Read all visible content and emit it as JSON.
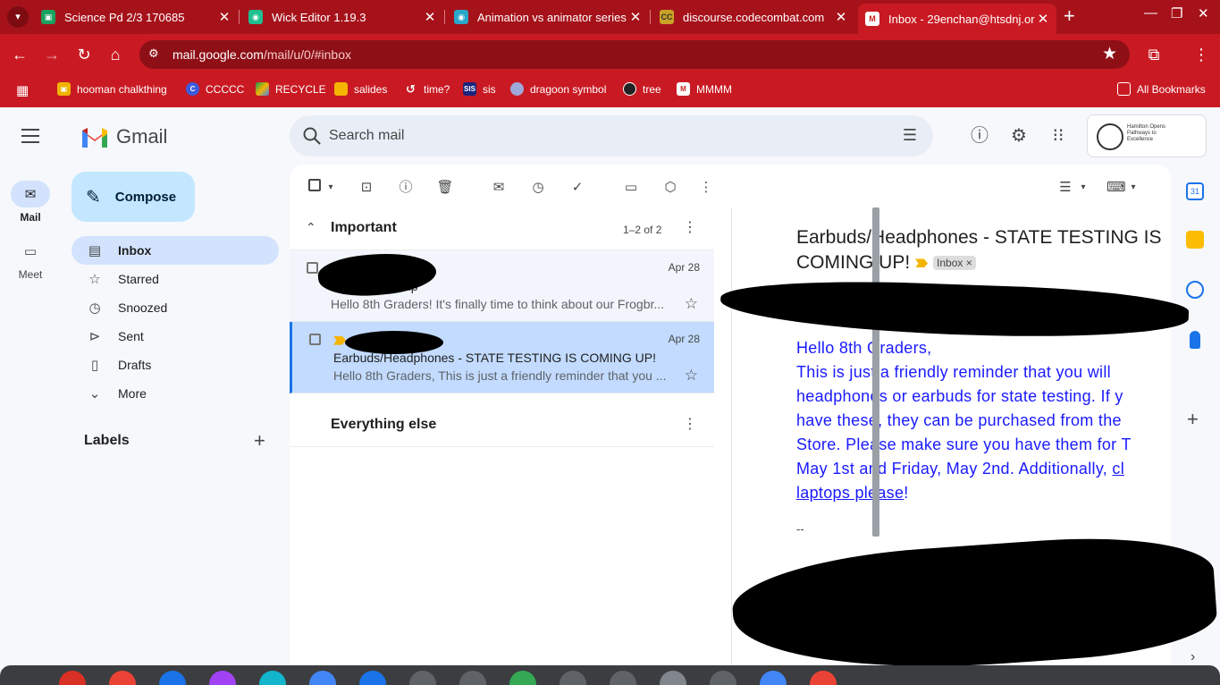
{
  "browser": {
    "tabs": [
      {
        "title": "Science Pd 2/3 170685",
        "active": false
      },
      {
        "title": "Wick Editor 1.19.3",
        "active": false
      },
      {
        "title": "Animation vs animator series",
        "active": false
      },
      {
        "title": "discourse.codecombat.com",
        "active": false
      },
      {
        "title": "Inbox - 29enchan@htsdnj.org",
        "active": true
      }
    ],
    "url_host": "mail.google.com",
    "url_path": "/mail/u/0/#inbox",
    "bookmarks": [
      {
        "label": "hooman chalkthing"
      },
      {
        "label": "CCCCC"
      },
      {
        "label": "RECYCLE"
      },
      {
        "label": "salides"
      },
      {
        "label": "time?"
      },
      {
        "label": "sis"
      },
      {
        "label": "dragoon symbol"
      },
      {
        "label": "tree"
      },
      {
        "label": "MMMM"
      }
    ],
    "all_bookmarks": "All Bookmarks",
    "colors": {
      "frame": "#a6121a",
      "toolbar": "#c91a23"
    }
  },
  "gmail": {
    "brand": "Gmail",
    "rail": [
      {
        "label": "Mail"
      },
      {
        "label": "Meet"
      }
    ],
    "compose": "Compose",
    "search_placeholder": "Search mail",
    "nav": [
      {
        "label": "Inbox",
        "icon": "inbox-icon"
      },
      {
        "label": "Starred",
        "icon": "star-icon"
      },
      {
        "label": "Snoozed",
        "icon": "clock-icon"
      },
      {
        "label": "Sent",
        "icon": "send-icon"
      },
      {
        "label": "Drafts",
        "icon": "draft-icon"
      },
      {
        "label": "More",
        "icon": "chevron-down-icon"
      }
    ],
    "labels_heading": "Labels",
    "account_org": "Hamilton Opens Pathways to Excellence",
    "list": {
      "important_title": "Important",
      "important_count": "1–2 of 2",
      "everything_else_title": "Everything else",
      "rows": [
        {
          "from_partial": "e",
          "date": "Apr 28",
          "subject_partial": "Trip",
          "snippet": "Hello 8th Graders! It's finally time to think about our Frogbr..."
        },
        {
          "from_partial": "",
          "date": "Apr 28",
          "subject": "Earbuds/Headphones - STATE TESTING IS COMING UP!",
          "snippet": "Hello 8th Graders, This is just a friendly reminder that you ..."
        }
      ]
    },
    "message": {
      "title_line1": "Earbuds/Headphones - STATE TESTING IS",
      "title_line2": "COMING UP!",
      "label_chip": "Inbox",
      "body_lines": [
        "Hello 8th Graders,",
        "This is just a friendly reminder that you will",
        "headphones or earbuds for state testing. If y",
        "have these, they can be purchased from the",
        "Store. Please make sure you have them for T",
        "May 1st and Friday, May 2nd. Additionally,"
      ],
      "body_link_tail": "cl",
      "body_link_line": "laptops please",
      "body_end": "!",
      "signature": "--"
    }
  }
}
